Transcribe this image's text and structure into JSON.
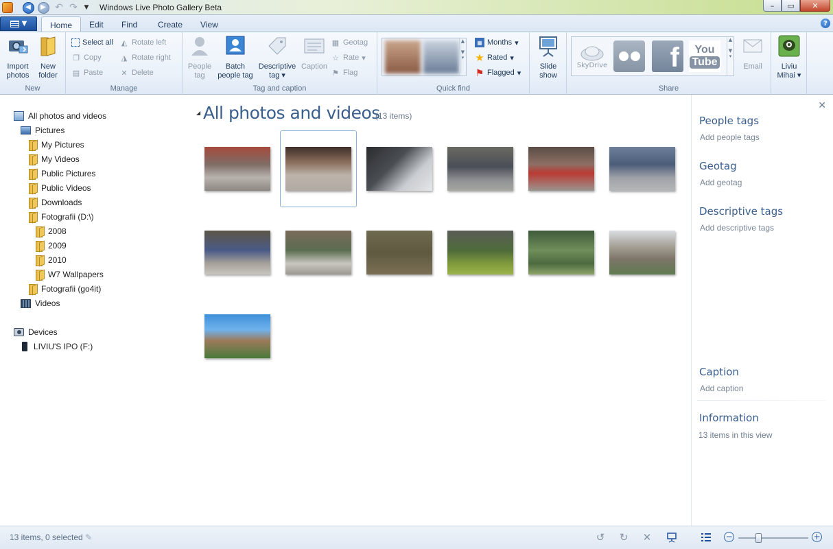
{
  "window": {
    "title": "Windows Live Photo Gallery Beta",
    "quick_access": {
      "back_icon": "back-arrow-icon",
      "forward_icon": "forward-arrow-icon",
      "undo_icon": "undo-icon",
      "redo_icon": "redo-icon"
    },
    "controls": {
      "minimize": "–",
      "maximize": "▭",
      "close": "✕"
    }
  },
  "tabs": [
    "Home",
    "Edit",
    "Find",
    "Create",
    "View"
  ],
  "active_tab": "Home",
  "ribbon": {
    "new": {
      "label": "New",
      "import_label": "Import photos",
      "import_l1": "Import",
      "import_l2": "photos",
      "folder_l1": "New",
      "folder_l2": "folder"
    },
    "manage": {
      "label": "Manage",
      "select_all": "Select all",
      "copy": "Copy",
      "paste": "Paste",
      "rotate_left": "Rotate left",
      "rotate_right": "Rotate right",
      "delete": "Delete"
    },
    "tag": {
      "label": "Tag and caption",
      "people_l1": "People",
      "people_l2": "tag",
      "batch_l1": "Batch",
      "batch_l2": "people tag",
      "desc_l1": "Descriptive",
      "desc_l2": "tag",
      "caption": "Caption",
      "geotag": "Geotag",
      "rate": "Rate",
      "flag": "Flag"
    },
    "quickfind": {
      "label": "Quick find",
      "months": "Months",
      "rated": "Rated",
      "flagged": "Flagged"
    },
    "slideshow": {
      "l1": "Slide",
      "l2": "show"
    },
    "share": {
      "label": "Share",
      "skydrive": "SkyDrive",
      "email": "Email"
    },
    "user": {
      "l1": "Liviu",
      "l2": "Mihai"
    }
  },
  "nav": {
    "all": "All photos and videos",
    "pictures": "Pictures",
    "my_pictures": "My Pictures",
    "my_videos": "My Videos",
    "public_pictures": "Public Pictures",
    "public_videos": "Public Videos",
    "downloads": "Downloads",
    "fotografii_d": "Fotografii (D:\\)",
    "y2008": "2008",
    "y2009": "2009",
    "y2010": "2010",
    "w7": "W7 Wallpapers",
    "fotografii_go4it": "Fotografii (go4it)",
    "videos": "Videos",
    "devices": "Devices",
    "ipod": "LIVIU'S IPO (F:)"
  },
  "main": {
    "title": "All photos and videos",
    "count": "(13 items)",
    "selected_index": 1
  },
  "rightpane": {
    "people_tags": "People tags",
    "add_people_tags": "Add people tags",
    "geotag": "Geotag",
    "add_geotag": "Add geotag",
    "descriptive_tags": "Descriptive tags",
    "add_descriptive_tags": "Add descriptive tags",
    "caption": "Caption",
    "add_caption": "Add caption",
    "information": "Information",
    "info_text": "13 items in this view"
  },
  "status": {
    "text": "13 items, 0 selected",
    "zoom_level": 0.28
  }
}
